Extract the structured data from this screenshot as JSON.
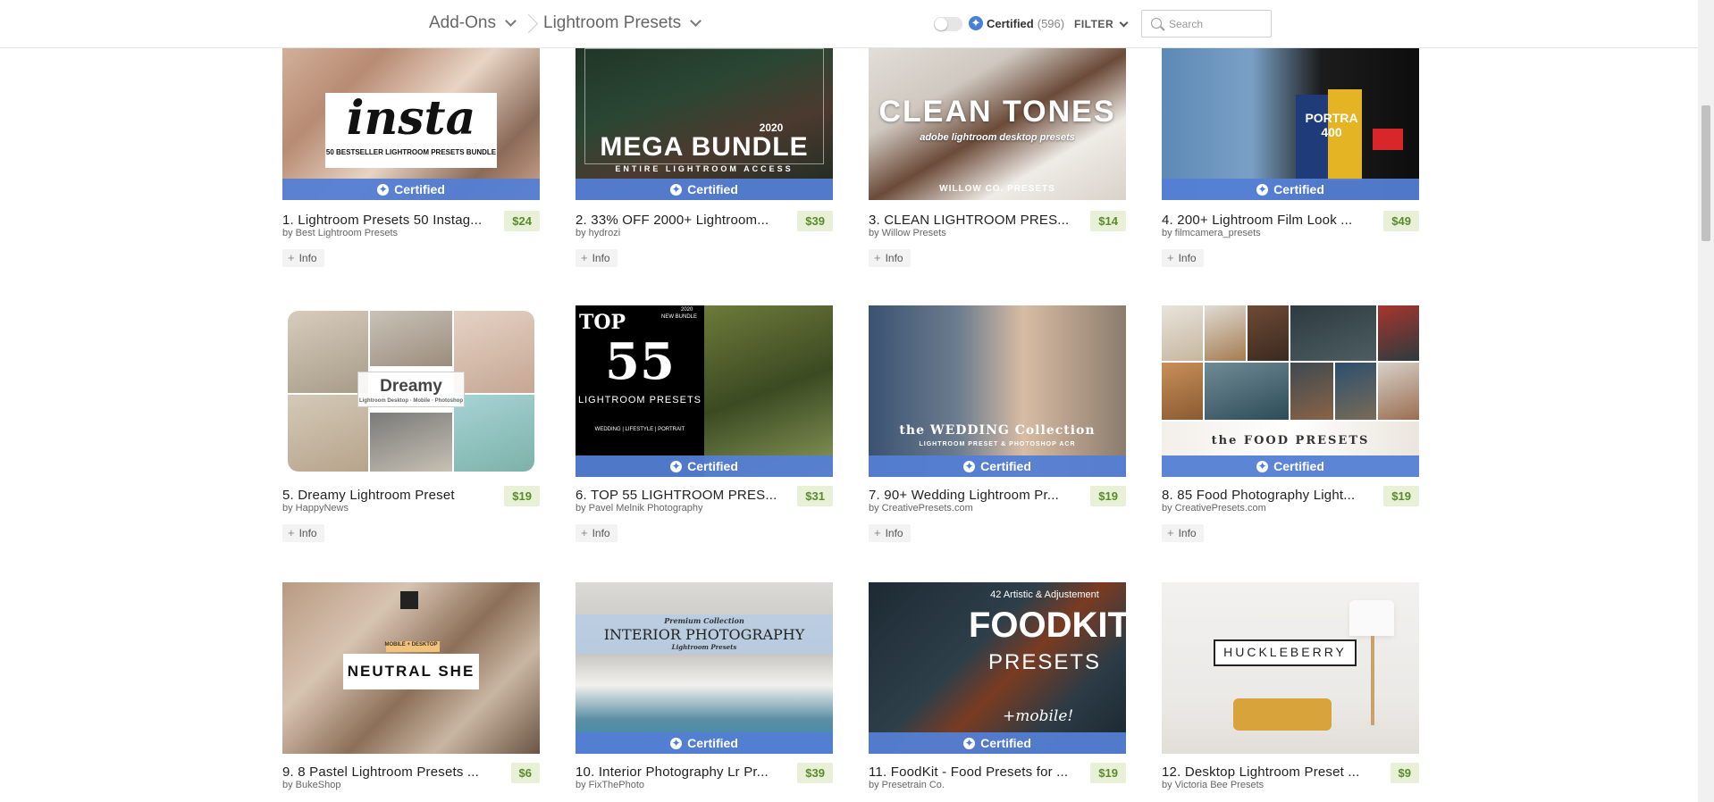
{
  "header": {
    "breadcrumb_1": "Add-Ons",
    "breadcrumb_2": "Lightroom Presets",
    "certified_label": "Certified",
    "certified_count": "(596)",
    "certified_icon": "✦",
    "filter_label": "FILTER",
    "search_placeholder": "Search"
  },
  "cert_badge_label": "Certified",
  "info_label": "Info",
  "products": [
    {
      "title": "1. Lightroom Presets 50 Instag...",
      "price": "$24",
      "author": "by Best Lightroom Presets",
      "certified": true,
      "thumb_text": "insta",
      "thumb_sub": "50 BESTSELLER LIGHTROOM PRESETS BUNDLE"
    },
    {
      "title": "2. 33% OFF 2000+ Lightroom...",
      "price": "$39",
      "author": "by hydrozi",
      "certified": true,
      "thumb_text": "MEGA BUNDLE",
      "thumb_sub": "ENTIRE LIGHTROOM ACCESS",
      "thumb_year": "2020"
    },
    {
      "title": "3. CLEAN LIGHTROOM PRES...",
      "price": "$14",
      "author": "by Willow Presets",
      "certified": false,
      "thumb_text": "CLEAN TONES",
      "thumb_sub": "adobe lightroom desktop presets",
      "thumb_foot": "WILLOW CO. PRESETS"
    },
    {
      "title": "4. 200+ Lightroom Film Look ...",
      "price": "$49",
      "author": "by filmcamera_presets",
      "certified": true,
      "thumb_text": "PORTRA 400"
    },
    {
      "title": "5. Dreamy Lightroom Preset",
      "price": "$19",
      "author": "by HappyNews",
      "certified": false,
      "thumb_text": "Dreamy",
      "thumb_sub": "Lightroom Desktop · Mobile · Photoshop"
    },
    {
      "title": "6. TOP 55 LIGHTROOM PRES...",
      "price": "$31",
      "author": "by Pavel Melnik Photography",
      "certified": true,
      "thumb_text": "55",
      "thumb_top": "TOP",
      "thumb_sub": "LIGHTROOM PRESETS",
      "thumb_foot": "WEDDING | LIFESTYLE | PORTRAIT",
      "thumb_year": "2020",
      "thumb_new": "NEW BUNDLE"
    },
    {
      "title": "7. 90+ Wedding Lightroom Pr...",
      "price": "$19",
      "author": "by CreativePresets.com",
      "certified": true,
      "thumb_text": "the WEDDING Collection",
      "thumb_sub": "LIGHTROOM PRESET & PHOTOSHOP ACR"
    },
    {
      "title": "8. 85 Food Photography Light...",
      "price": "$19",
      "author": "by CreativePresets.com",
      "certified": true,
      "thumb_text": "the FOOD PRESETS"
    },
    {
      "title": "9. 8 Pastel Lightroom Presets ...",
      "price": "$6",
      "author": "by BukeShop",
      "certified": false,
      "thumb_text": "NEUTRAL SHE",
      "thumb_sub": "MOBILE + DESKTOP"
    },
    {
      "title": "10. Interior Photography Lr Pr...",
      "price": "$39",
      "author": "by FixThePhoto",
      "certified": true,
      "thumb_text": "INTERIOR PHOTOGRAPHY",
      "thumb_top": "Premium Collection",
      "thumb_sub": "Lightroom Presets"
    },
    {
      "title": "11. FoodKit - Food Presets for ...",
      "price": "$19",
      "author": "by Presetrain Co.",
      "certified": true,
      "thumb_text": "FOODKIT",
      "thumb_top": "42 Artistic & Adjustement",
      "thumb_sub": "PRESETS",
      "thumb_foot": "+mobile!"
    },
    {
      "title": "12. Desktop Lightroom Preset ...",
      "price": "$9",
      "author": "by Victoria Bee Presets",
      "certified": false,
      "thumb_text": "HUCKLEBERRY"
    }
  ]
}
